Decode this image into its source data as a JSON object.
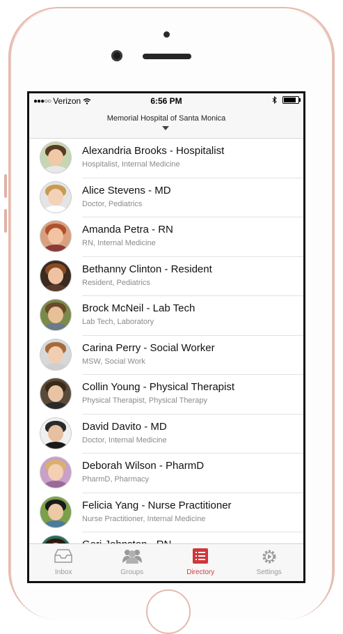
{
  "status": {
    "carrier": "Verizon",
    "time": "6:56 PM"
  },
  "header": {
    "title": "Memorial Hospital of Santa Monica"
  },
  "contacts": [
    {
      "name": "Alexandria Brooks - Hospitalist",
      "role": "Hospitalist, Internal Medicine"
    },
    {
      "name": "Alice Stevens - MD",
      "role": "Doctor, Pediatrics"
    },
    {
      "name": "Amanda Petra - RN",
      "role": "RN, Internal Medicine"
    },
    {
      "name": "Bethanny Clinton - Resident",
      "role": "Resident, Pediatrics"
    },
    {
      "name": "Brock McNeil - Lab Tech",
      "role": "Lab Tech, Laboratory"
    },
    {
      "name": "Carina Perry - Social Worker",
      "role": "MSW, Social Work"
    },
    {
      "name": "Collin Young - Physical Therapist",
      "role": "Physical Therapist, Physical Therapy"
    },
    {
      "name": "David Davito - MD",
      "role": "Doctor, Internal Medicine"
    },
    {
      "name": "Deborah Wilson - PharmD",
      "role": "PharmD, Pharmacy"
    },
    {
      "name": "Felicia Yang - Nurse Practitioner",
      "role": "Nurse Practitioner, Internal Medicine"
    },
    {
      "name": "Geri Johnston - RN",
      "role": ""
    }
  ],
  "tabs": [
    {
      "label": "Inbox",
      "icon": "inbox-icon"
    },
    {
      "label": "Groups",
      "icon": "groups-icon"
    },
    {
      "label": "Directory",
      "icon": "directory-icon",
      "active": true
    },
    {
      "label": "Settings",
      "icon": "settings-icon"
    }
  ],
  "colors": {
    "accent": "#d0363b",
    "phone_rim": "#e9c2b9"
  }
}
